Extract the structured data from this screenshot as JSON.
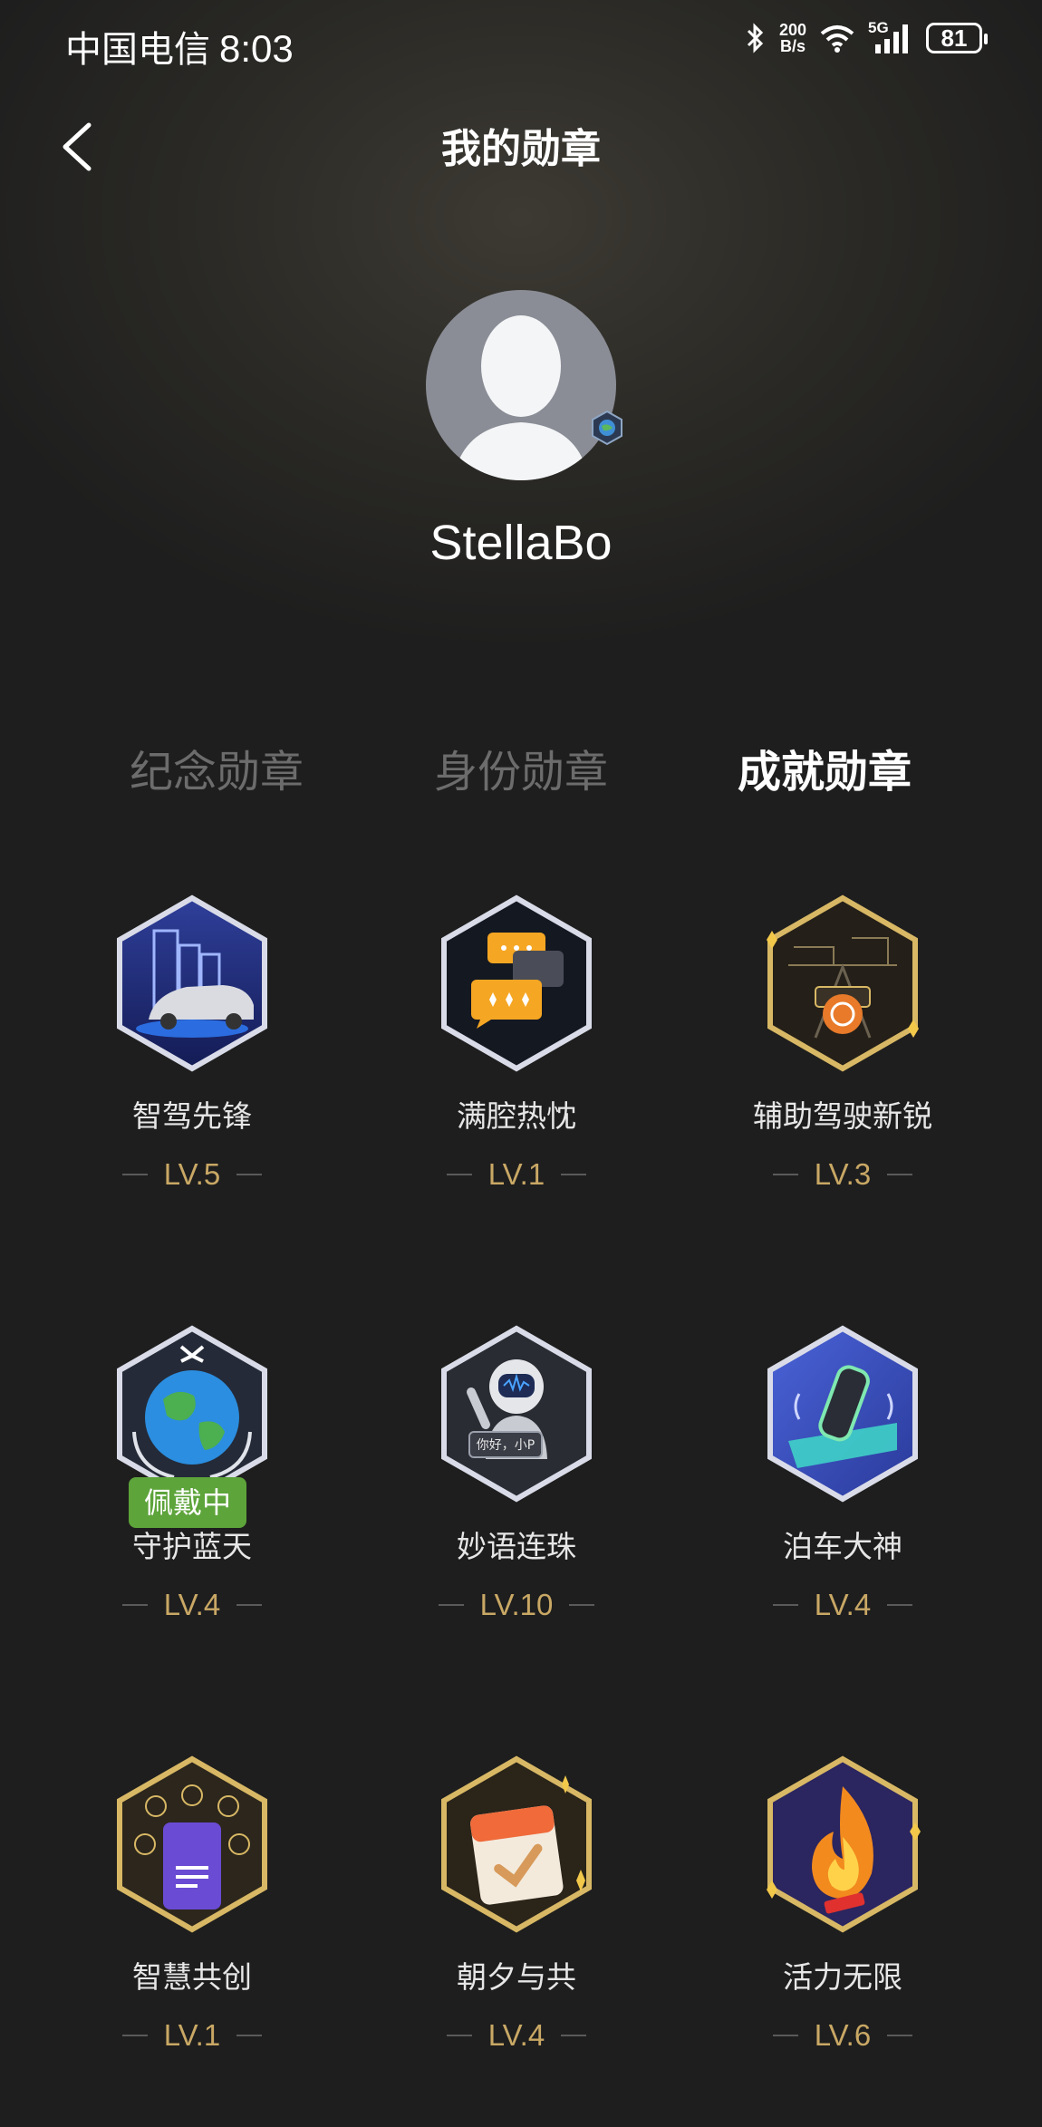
{
  "status_bar": {
    "carrier": "中国电信",
    "time": "8:03",
    "speed_value": "200",
    "speed_unit": "B/s",
    "network": "5G",
    "battery": "81"
  },
  "header": {
    "title": "我的勋章",
    "back_icon": "chevron-left-icon"
  },
  "profile": {
    "username": "StellaBo"
  },
  "tabs": [
    {
      "label": "纪念勋章",
      "active": false
    },
    {
      "label": "身份勋章",
      "active": false
    },
    {
      "label": "成就勋章",
      "active": true
    }
  ],
  "badges": [
    {
      "name": "智驾先锋",
      "level": "LV.5",
      "icon": "city-car-icon"
    },
    {
      "name": "满腔热忱",
      "level": "LV.1",
      "icon": "chat-bubbles-icon"
    },
    {
      "name": "辅助驾驶新锐",
      "level": "LV.3",
      "icon": "steering-wheel-road-icon"
    },
    {
      "name": "守护蓝天",
      "level": "LV.4",
      "icon": "globe-icon",
      "tag": "佩戴中"
    },
    {
      "name": "妙语连珠",
      "level": "LV.10",
      "icon": "astronaut-icon",
      "bubble_text": "你好，小P"
    },
    {
      "name": "泊车大神",
      "level": "LV.4",
      "icon": "parking-car-icon"
    },
    {
      "name": "智慧共创",
      "level": "LV.1",
      "icon": "phone-apps-icon"
    },
    {
      "name": "朝夕与共",
      "level": "LV.4",
      "icon": "calendar-check-icon"
    },
    {
      "name": "活力无限",
      "level": "LV.6",
      "icon": "flame-icon"
    }
  ],
  "colors": {
    "accent_gold": "#c9a865",
    "wearing_green": "#5da43a"
  }
}
